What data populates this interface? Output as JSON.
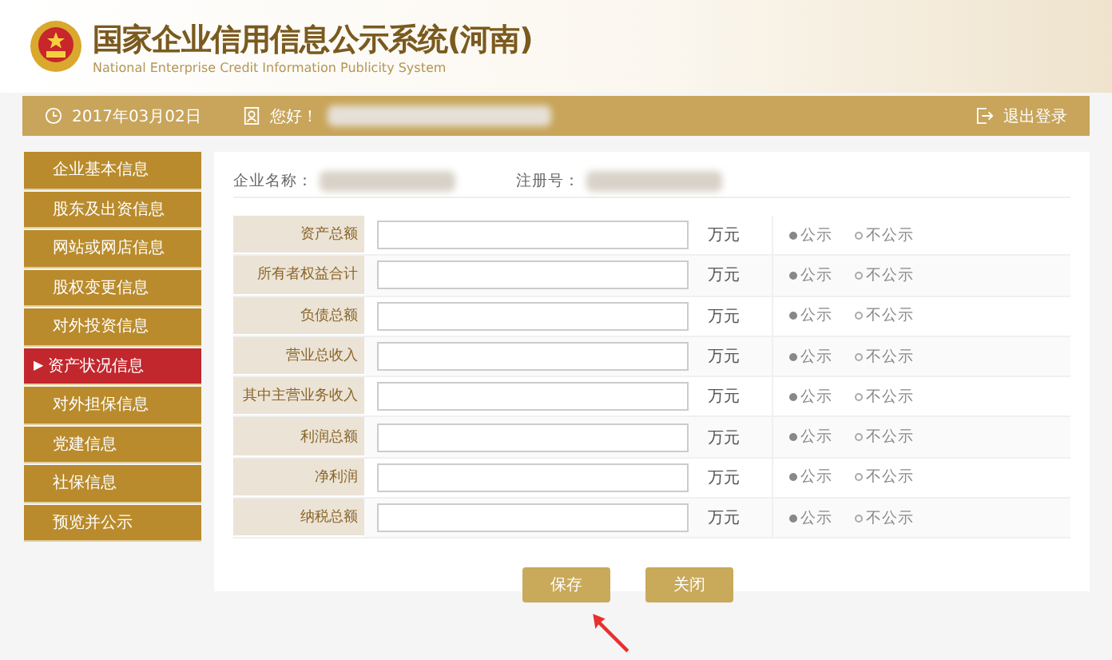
{
  "header": {
    "title": "国家企业信用信息公示系统(河南)",
    "subtitle": "National Enterprise Credit Information Publicity System"
  },
  "top_bar": {
    "date": "2017年03月02日",
    "greeting": "您好！",
    "logout": "退出登录"
  },
  "sidebar": {
    "items": [
      {
        "label": "企业基本信息",
        "selected": false
      },
      {
        "label": "股东及出资信息",
        "selected": false
      },
      {
        "label": "网站或网店信息",
        "selected": false
      },
      {
        "label": "股权变更信息",
        "selected": false
      },
      {
        "label": "对外投资信息",
        "selected": false
      },
      {
        "label": "资产状况信息",
        "selected": true,
        "marker": "▶"
      },
      {
        "label": "对外担保信息",
        "selected": false
      },
      {
        "label": "党建信息",
        "selected": false
      },
      {
        "label": "社保信息",
        "selected": false
      },
      {
        "label": "预览并公示",
        "selected": false
      }
    ]
  },
  "info": {
    "company_label": "企业名称：",
    "reg_label": "注册号："
  },
  "form": {
    "rows": [
      {
        "label": "资产总额",
        "unit": "万元",
        "options": [
          {
            "label": "公示",
            "selected": true
          },
          {
            "label": "不公示",
            "selected": false
          }
        ]
      },
      {
        "label": "所有者权益合计",
        "unit": "万元",
        "options": [
          {
            "label": "公示",
            "selected": true
          },
          {
            "label": "不公示",
            "selected": false
          }
        ]
      },
      {
        "label": "负债总额",
        "unit": "万元",
        "options": [
          {
            "label": "公示",
            "selected": true
          },
          {
            "label": "不公示",
            "selected": false
          }
        ]
      },
      {
        "label": "营业总收入",
        "unit": "万元",
        "options": [
          {
            "label": "公示",
            "selected": true
          },
          {
            "label": "不公示",
            "selected": false
          }
        ]
      },
      {
        "label": "其中主营业务收入",
        "unit": "万元",
        "options": [
          {
            "label": "公示",
            "selected": true
          },
          {
            "label": "不公示",
            "selected": false
          }
        ]
      },
      {
        "label": "利润总额",
        "unit": "万元",
        "options": [
          {
            "label": "公示",
            "selected": true
          },
          {
            "label": "不公示",
            "selected": false
          }
        ]
      },
      {
        "label": "净利润",
        "unit": "万元",
        "options": [
          {
            "label": "公示",
            "selected": true
          },
          {
            "label": "不公示",
            "selected": false
          }
        ]
      },
      {
        "label": "纳税总额",
        "unit": "万元",
        "options": [
          {
            "label": "公示",
            "selected": true
          },
          {
            "label": "不公示",
            "selected": false
          }
        ]
      }
    ]
  },
  "buttons": [
    {
      "label": "保存"
    },
    {
      "label": "关闭"
    }
  ]
}
